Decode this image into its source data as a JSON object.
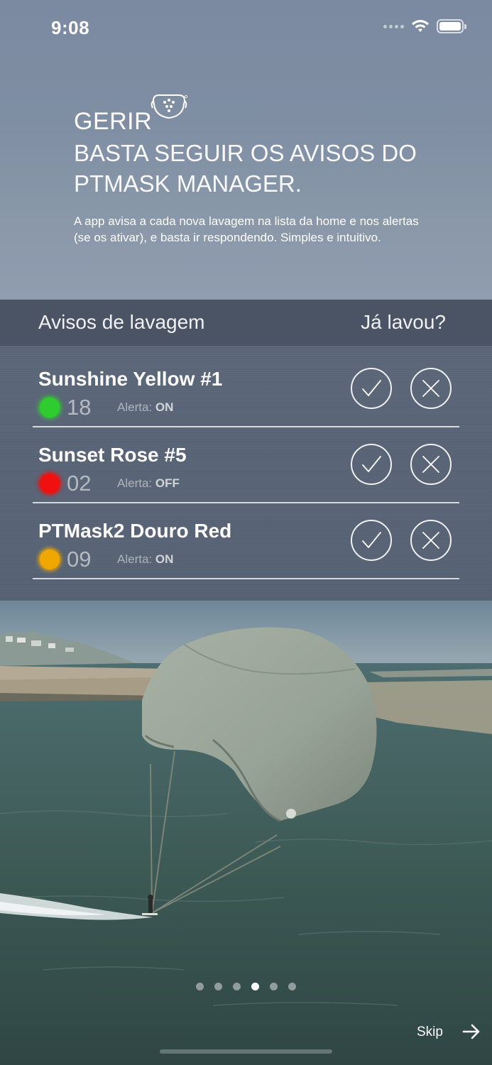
{
  "status_bar": {
    "time": "9:08"
  },
  "heading": {
    "title": "GERIR",
    "subtitle": "BASTA SEGUIR OS AVISOS DO PTMASK MANAGER.",
    "body": "A app avisa a cada nova lavagem na lista da home e nos alertas (se os ativar), e basta ir respondendo. Simples e intuitivo."
  },
  "card": {
    "header_title": "Avisos de lavagem",
    "header_question": "Já lavou?",
    "rows": [
      {
        "name": "Sunshine Yellow #1",
        "count": "18",
        "status_color": "#2ecc2e",
        "alert_label": "Alerta:",
        "alert_value": "ON"
      },
      {
        "name": "Sunset Rose #5",
        "count": "02",
        "status_color": "#f01010",
        "alert_label": "Alerta:",
        "alert_value": "OFF"
      },
      {
        "name": "PTMask2 Douro Red",
        "count": "09",
        "status_color": "#f0a800",
        "alert_label": "Alerta:",
        "alert_value": "ON"
      }
    ]
  },
  "footer": {
    "skip_label": "Skip",
    "pages_total": 6,
    "active_page_index": 3
  },
  "icons": {
    "logo": "mask-logo-icon",
    "confirm": "check-icon",
    "reject": "close-icon",
    "next": "arrow-right-icon"
  }
}
